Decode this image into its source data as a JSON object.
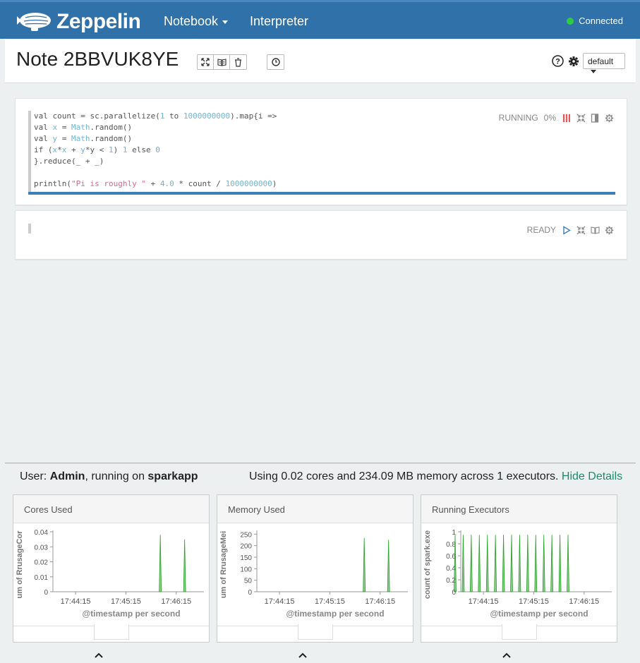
{
  "nav": {
    "brand": "Zeppelin",
    "notebook": "Notebook",
    "interpreter": "Interpreter",
    "status": "Connected",
    "status_color": "#2ecc40"
  },
  "note": {
    "title": "Note 2BBVUK8YE",
    "default_label": "default"
  },
  "paragraph1": {
    "status": "RUNNING",
    "progress": "0%",
    "progress_value": 0,
    "code_lines": [
      "val count = sc.parallelize(1 to 1000000000).map{i =>",
      "val x = Math.random()",
      "val y = Math.random()",
      "if (x*x + y*y < 1) 1 else 0",
      "}.reduce(_ + _)",
      "",
      "println(\"Pi is roughly \" + 4.0 * count / 1000000000)"
    ]
  },
  "paragraph2": {
    "status": "READY"
  },
  "bottom": {
    "user_prefix": "User: ",
    "user": "Admin",
    "running_on": ", running on ",
    "app": "sparkapp",
    "usage_prefix": "Using ",
    "cores": "0.02",
    "cores_text": " cores and ",
    "memory": "234.09 MB",
    "memory_text": " memory across ",
    "executors": "1",
    "executors_text": " executors. ",
    "hide_details": "Hide Details"
  },
  "chart_data": [
    {
      "type": "area",
      "title": "Cores Used",
      "xlabel": "@timestamp per second",
      "ylabel": "um of RrusageCor",
      "x_ticks": [
        "17:44:15",
        "17:45:15",
        "17:46:15"
      ],
      "y_ticks": [
        "0",
        "0.01",
        "0.02",
        "0.03",
        "0.04"
      ],
      "ylim": [
        0,
        0.04
      ],
      "series_color": "#2ca02c",
      "spikes": [
        {
          "time": "17:45:56",
          "value": 0.038
        },
        {
          "time": "17:46:25",
          "value": 0.035
        }
      ]
    },
    {
      "type": "area",
      "title": "Memory Used",
      "xlabel": "@timestamp per second",
      "ylabel": "um of RrusageMei",
      "x_ticks": [
        "17:44:15",
        "17:45:15",
        "17:46:15"
      ],
      "y_ticks": [
        "0",
        "50",
        "100",
        "150",
        "200",
        "250"
      ],
      "ylim": [
        0,
        260
      ],
      "series_color": "#2ca02c",
      "spikes": [
        {
          "time": "17:45:56",
          "value": 234
        },
        {
          "time": "17:46:25",
          "value": 225
        }
      ]
    },
    {
      "type": "area",
      "title": "Running Executors",
      "xlabel": "@timestamp per second",
      "ylabel": "count of spark.exe",
      "x_ticks": [
        "17:44:15",
        "17:45:15",
        "17:46:15"
      ],
      "y_ticks": [
        "0",
        "0.2",
        "0.4",
        "0.6",
        "0.8",
        "1"
      ],
      "ylim": [
        0,
        1
      ],
      "series_color": "#2ca02c",
      "spikes_uniform": {
        "count": 15,
        "value": 0.95
      }
    }
  ]
}
